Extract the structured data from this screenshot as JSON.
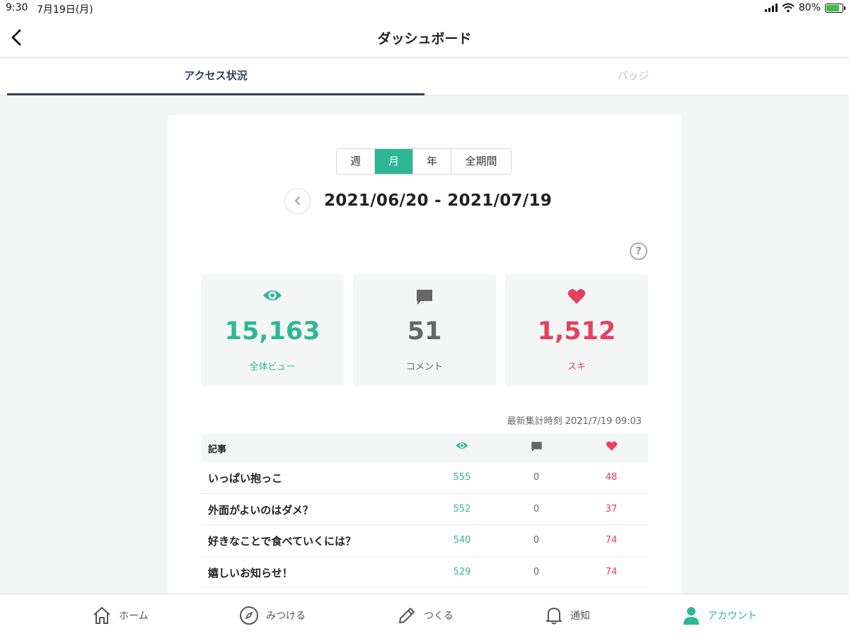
{
  "status_bar": {
    "time": "9:30",
    "date": "7月19日(月)",
    "battery": "80%"
  },
  "nav": {
    "title": "ダッシュボード"
  },
  "tabs": [
    {
      "label": "アクセス状況",
      "active": true
    },
    {
      "label": "バッジ",
      "active": false
    }
  ],
  "period_selector": {
    "options": [
      "週",
      "月",
      "年",
      "全期間"
    ],
    "selected": "月"
  },
  "date_range": "2021/06/20 - 2021/07/19",
  "help_label": "?",
  "stats": {
    "views": {
      "value": "15,163",
      "label": "全体ビュー",
      "icon": "eye-icon"
    },
    "comments": {
      "value": "51",
      "label": "コメント",
      "icon": "comment-icon"
    },
    "likes": {
      "value": "1,512",
      "label": "スキ",
      "icon": "heart-icon"
    }
  },
  "updated_at": "最新集計時刻 2021/7/19 09:03",
  "table": {
    "header_title": "記事",
    "rows": [
      {
        "title": "いっぱい抱っこ",
        "views": "555",
        "comments": "0",
        "likes": "48"
      },
      {
        "title": "外面がよいのはダメ？",
        "views": "552",
        "comments": "0",
        "likes": "37"
      },
      {
        "title": "好きなことで食べていくには？",
        "views": "540",
        "comments": "0",
        "likes": "74"
      },
      {
        "title": "嬉しいお知らせ！",
        "views": "529",
        "comments": "0",
        "likes": "74"
      }
    ]
  },
  "tabbar": [
    {
      "label": "ホーム",
      "icon": "home-icon"
    },
    {
      "label": "みつける",
      "icon": "compass-icon"
    },
    {
      "label": "つくる",
      "icon": "pencil-icon"
    },
    {
      "label": "通知",
      "icon": "bell-icon"
    },
    {
      "label": "アカウント",
      "icon": "person-icon",
      "active": true
    }
  ],
  "colors": {
    "accent": "#2eb795",
    "like": "#e5405f",
    "tab_active": "#2f3f5c"
  }
}
